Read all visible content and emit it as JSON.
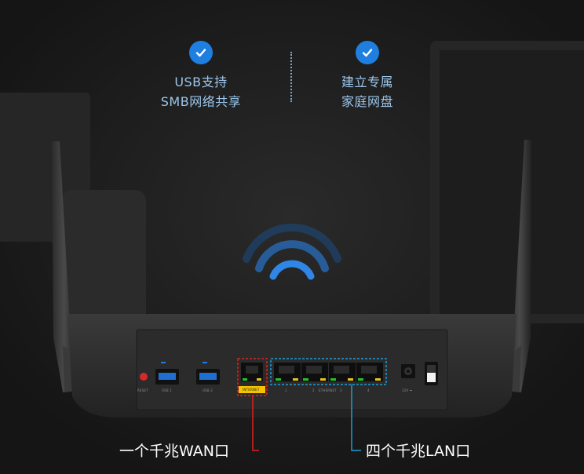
{
  "features": [
    {
      "icon": "check-circle-icon",
      "lines": [
        "USB支持",
        "SMB网络共享"
      ]
    },
    {
      "icon": "check-circle-icon",
      "lines": [
        "建立专属",
        "家庭网盘"
      ]
    }
  ],
  "router": {
    "reset_label": "RESET",
    "usb_labels": [
      "USB 1",
      "USB 2"
    ],
    "internet_label": "INTERNET",
    "ethernet_label": "ETHERNET",
    "lan_numbers": [
      "1",
      "2",
      "3",
      "4"
    ],
    "power_label": "12V ⎓"
  },
  "callouts": {
    "wan": "一个千兆WAN口",
    "lan": "四个千兆LAN口"
  },
  "colors": {
    "accent_blue": "#1f7fe0",
    "wan_highlight": "#e02020",
    "lan_highlight": "#1e9bd7",
    "internet_tag": "#f5c400",
    "feature_text": "#9cc6ea"
  }
}
